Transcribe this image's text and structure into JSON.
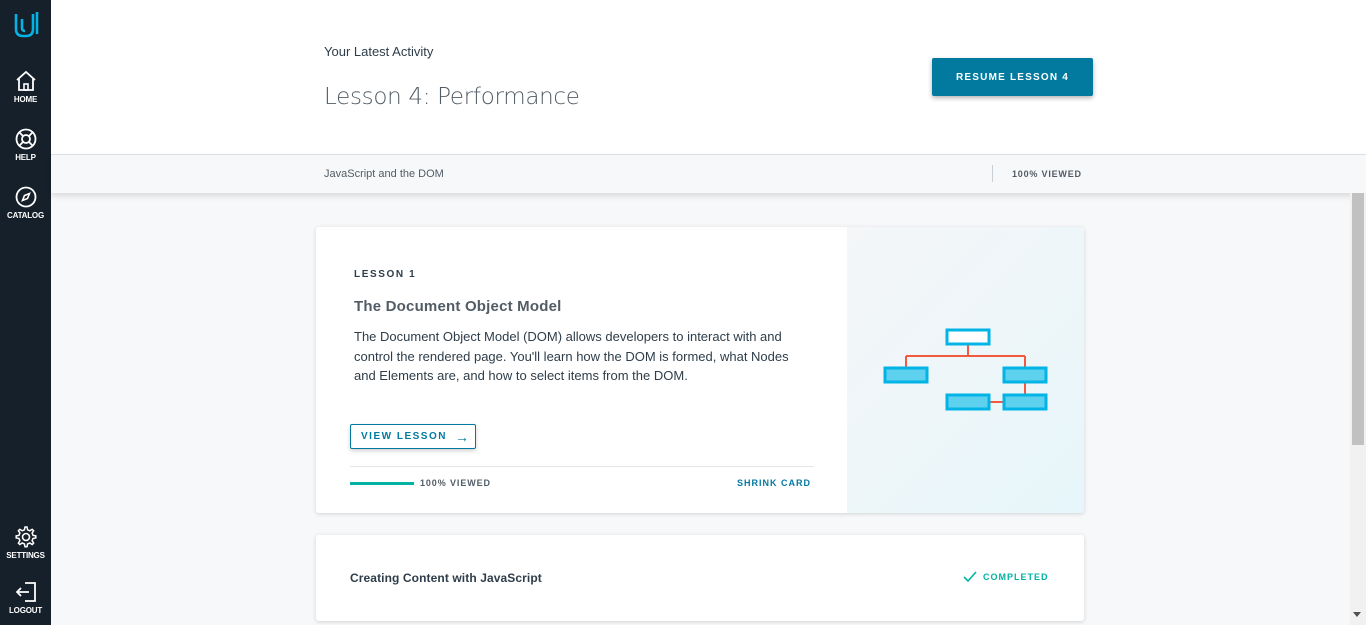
{
  "sidebar": {
    "logo": "udacity-logo",
    "items": [
      {
        "label": "HOME",
        "icon": "home-icon"
      },
      {
        "label": "HELP",
        "icon": "lifebuoy-icon"
      },
      {
        "label": "CATALOG",
        "icon": "compass-icon"
      },
      {
        "label": "SETTINGS",
        "icon": "gear-icon"
      },
      {
        "label": "LOGOUT",
        "icon": "logout-icon"
      }
    ]
  },
  "header": {
    "subtitle": "Your Latest Activity",
    "title": "Lesson 4: Performance",
    "resume_button": "RESUME LESSON 4"
  },
  "subheader": {
    "course": "JavaScript and the DOM",
    "viewed": "100% VIEWED"
  },
  "lesson_card": {
    "tag": "LESSON 1",
    "title": "The Document Object Model",
    "description": "The Document Object Model (DOM) allows developers to interact with and control the rendered page. You'll learn how the DOM is formed, what Nodes and Elements are, and how to select items from the DOM.",
    "view_button": "VIEW LESSON",
    "progress_fraction": 1.0,
    "progress_label": "100% VIEWED",
    "shrink_label": "SHRINK CARD",
    "image_icon": "dom-tree-diagram",
    "colors": {
      "accent": "#02b3a4",
      "primary": "#02799e",
      "diagram_box": "#02b4e6",
      "diagram_line": "#f15a3f"
    }
  },
  "next_card": {
    "title": "Creating Content with JavaScript",
    "status": "COMPLETED"
  }
}
